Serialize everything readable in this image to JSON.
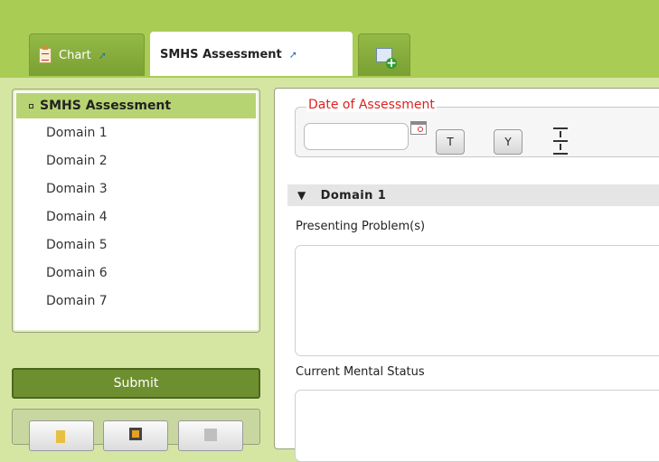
{
  "tabs": [
    {
      "label": "Chart",
      "icon": "clipboard-icon",
      "pinned": true
    },
    {
      "label": "SMHS Assessment",
      "pinned": true,
      "active": true
    }
  ],
  "new_tab_icon": "add-tab-icon",
  "nav": {
    "selected": "SMHS Assessment",
    "items": [
      "Domain 1",
      "Domain 2",
      "Domain 3",
      "Domain 4",
      "Domain 5",
      "Domain 6",
      "Domain 7"
    ]
  },
  "actions": {
    "submit_label": "Submit"
  },
  "form": {
    "date_legend": "Date of Assessment",
    "date_value": "",
    "today_label": "T",
    "yesterday_label": "Y",
    "section_title": "Domain 1",
    "presenting_label": "Presenting Problem(s)",
    "presenting_value": "",
    "mental_status_label": "Current Mental Status",
    "mental_status_value": ""
  },
  "colors": {
    "header_green": "#a9cc55",
    "panel_bg": "#d5e6a3",
    "selected_item": "#b7d473",
    "submit_green": "#6e8f2f",
    "legend_red": "#e02020"
  }
}
